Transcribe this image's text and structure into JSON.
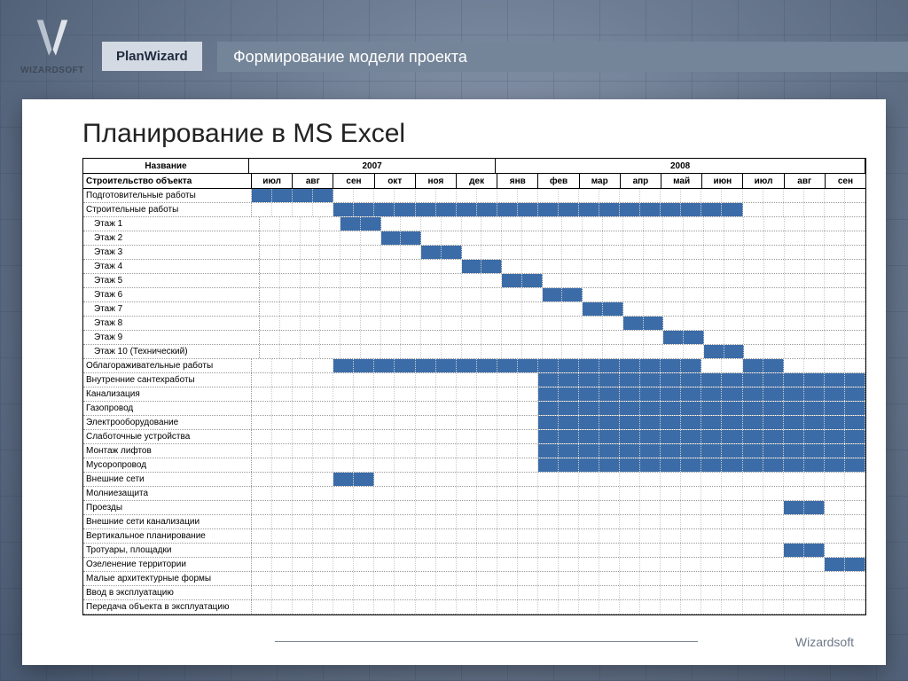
{
  "logo_text": "WIZARDSOFT",
  "product": "PlanWizard",
  "title": "Формирование модели проекта",
  "slide_title": "Планирование в MS Excel",
  "footer": "Wizardsoft",
  "chart_data": {
    "type": "bar",
    "title": "Планирование в MS Excel",
    "xlabel": "",
    "ylabel": "",
    "name_header": "Название",
    "object_label": "Строительство объекта",
    "years": [
      {
        "label": "2007",
        "months": [
          "июл",
          "авг",
          "сен",
          "окт",
          "ноя",
          "дек"
        ]
      },
      {
        "label": "2008",
        "months": [
          "янв",
          "фев",
          "мар",
          "апр",
          "май",
          "июн",
          "июл",
          "авг",
          "сен"
        ]
      }
    ],
    "halves_per_month": 2,
    "tasks": [
      {
        "name": "Подготовительные работы",
        "indent": 0,
        "bars": [
          [
            0,
            4
          ]
        ]
      },
      {
        "name": "Строительные работы",
        "indent": 0,
        "bars": [
          [
            4,
            24
          ]
        ]
      },
      {
        "name": "Этаж 1",
        "indent": 1,
        "bars": [
          [
            4,
            6
          ]
        ]
      },
      {
        "name": "Этаж 2",
        "indent": 1,
        "bars": [
          [
            6,
            8
          ]
        ]
      },
      {
        "name": "Этаж 3",
        "indent": 1,
        "bars": [
          [
            8,
            10
          ]
        ]
      },
      {
        "name": "Этаж 4",
        "indent": 1,
        "bars": [
          [
            10,
            12
          ]
        ]
      },
      {
        "name": "Этаж 5",
        "indent": 1,
        "bars": [
          [
            12,
            14
          ]
        ]
      },
      {
        "name": "Этаж 6",
        "indent": 1,
        "bars": [
          [
            14,
            16
          ]
        ]
      },
      {
        "name": "Этаж 7",
        "indent": 1,
        "bars": [
          [
            16,
            18
          ]
        ]
      },
      {
        "name": "Этаж 8",
        "indent": 1,
        "bars": [
          [
            18,
            20
          ]
        ]
      },
      {
        "name": "Этаж 9",
        "indent": 1,
        "bars": [
          [
            20,
            22
          ]
        ]
      },
      {
        "name": "Этаж 10 (Технический)",
        "indent": 1,
        "bars": [
          [
            22,
            24
          ]
        ]
      },
      {
        "name": "Облагораживательные работы",
        "indent": 0,
        "bars": [
          [
            4,
            22
          ],
          [
            24,
            26
          ]
        ]
      },
      {
        "name": "Внутренние сантехработы",
        "indent": 0,
        "bars": [
          [
            14,
            30
          ]
        ]
      },
      {
        "name": "Канализация",
        "indent": 0,
        "bars": [
          [
            14,
            30
          ]
        ]
      },
      {
        "name": "Газопровод",
        "indent": 0,
        "bars": [
          [
            14,
            30
          ]
        ]
      },
      {
        "name": "Электрооборудование",
        "indent": 0,
        "bars": [
          [
            14,
            30
          ]
        ]
      },
      {
        "name": "Слаботочные устройства",
        "indent": 0,
        "bars": [
          [
            14,
            30
          ]
        ]
      },
      {
        "name": "Монтаж лифтов",
        "indent": 0,
        "bars": [
          [
            14,
            30
          ]
        ]
      },
      {
        "name": "Мусоропровод",
        "indent": 0,
        "bars": [
          [
            14,
            30
          ]
        ]
      },
      {
        "name": "Внешние сети",
        "indent": 0,
        "bars": [
          [
            4,
            6
          ]
        ]
      },
      {
        "name": "Молниезащита",
        "indent": 0,
        "bars": []
      },
      {
        "name": "Проезды",
        "indent": 0,
        "bars": [
          [
            26,
            28
          ]
        ]
      },
      {
        "name": "Внешние сети канализации",
        "indent": 0,
        "bars": []
      },
      {
        "name": "Вертикальное планирование",
        "indent": 0,
        "bars": []
      },
      {
        "name": "Тротуары, площадки",
        "indent": 0,
        "bars": [
          [
            26,
            28
          ]
        ]
      },
      {
        "name": "Озеленение территории",
        "indent": 0,
        "bars": [
          [
            28,
            30
          ]
        ]
      },
      {
        "name": "Малые архитектурные формы",
        "indent": 0,
        "bars": []
      },
      {
        "name": "Ввод  в эксплуатацию",
        "indent": 0,
        "bars": []
      },
      {
        "name": "Передача объекта в эксплуатацию",
        "indent": 0,
        "bars": []
      }
    ]
  }
}
